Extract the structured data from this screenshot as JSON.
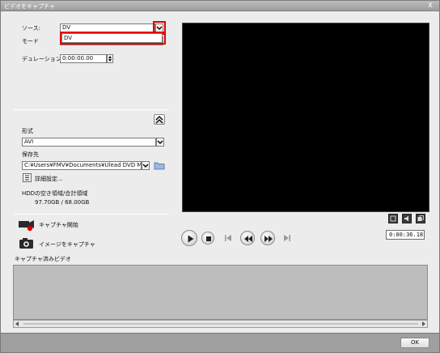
{
  "window": {
    "title": "ビデオをキャプチャ",
    "close_glyph": "X"
  },
  "source": {
    "label": "ソース:",
    "value": "DV",
    "dropdown_option": "DV"
  },
  "mode": {
    "label": "モード"
  },
  "duration": {
    "label": "デュレーション",
    "value": "0:00:00.00"
  },
  "format": {
    "label": "形式",
    "value": "AVI"
  },
  "save_to": {
    "label": "保存先",
    "value": "C:¥Users¥FMV¥Documents¥Ulead DVD Movie"
  },
  "details": {
    "label": "詳細設定..."
  },
  "hdd": {
    "label": "HDDの空き領域/合計領域",
    "value": "97.70GB / 68.00GB"
  },
  "actions": {
    "capture_start": "キャプチャ開始",
    "capture_image": "イメージをキャプチャ"
  },
  "captured": {
    "label": "キャプチャ済みビデオ"
  },
  "player": {
    "timecode": "0:00:36.18"
  },
  "footer": {
    "ok": "OK"
  },
  "colors": {
    "highlight": "#e30000",
    "video_bg": "#000000",
    "panel": "#bdbdbd"
  }
}
